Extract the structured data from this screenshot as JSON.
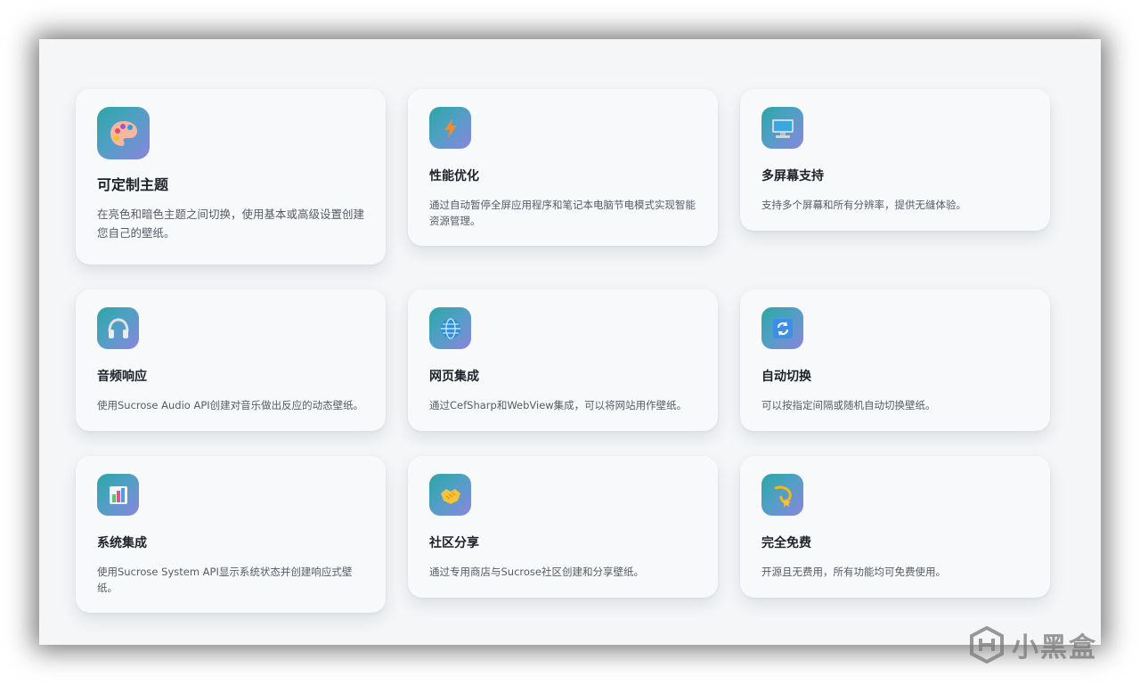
{
  "features": [
    {
      "icon": "palette-icon",
      "title": "可定制主题",
      "desc": "在亮色和暗色主题之间切换，使用基本或高级设置创建您自己的壁纸。"
    },
    {
      "icon": "lightning-icon",
      "title": "性能优化",
      "desc": "通过自动暂停全屏应用程序和笔记本电脑节电模式实现智能资源管理。"
    },
    {
      "icon": "monitor-icon",
      "title": "多屏幕支持",
      "desc": "支持多个屏幕和所有分辨率，提供无缝体验。"
    },
    {
      "icon": "headphones-icon",
      "title": "音频响应",
      "desc": "使用Sucrose Audio API创建对音乐做出反应的动态壁纸。"
    },
    {
      "icon": "globe-icon",
      "title": "网页集成",
      "desc": "通过CefSharp和WebView集成，可以将网站用作壁纸。"
    },
    {
      "icon": "refresh-icon",
      "title": "自动切换",
      "desc": "可以按指定间隔或随机自动切换壁纸。"
    },
    {
      "icon": "bar-chart-icon",
      "title": "系统集成",
      "desc": "使用Sucrose System API显示系统状态并创建响应式壁纸。"
    },
    {
      "icon": "handshake-icon",
      "title": "社区分享",
      "desc": "通过专用商店与Sucrose社区创建和分享壁纸。"
    },
    {
      "icon": "dizzy-icon",
      "title": "完全免费",
      "desc": "开源且无费用，所有功能均可免费使用。"
    }
  ],
  "watermark": {
    "text": "小黑盒"
  }
}
